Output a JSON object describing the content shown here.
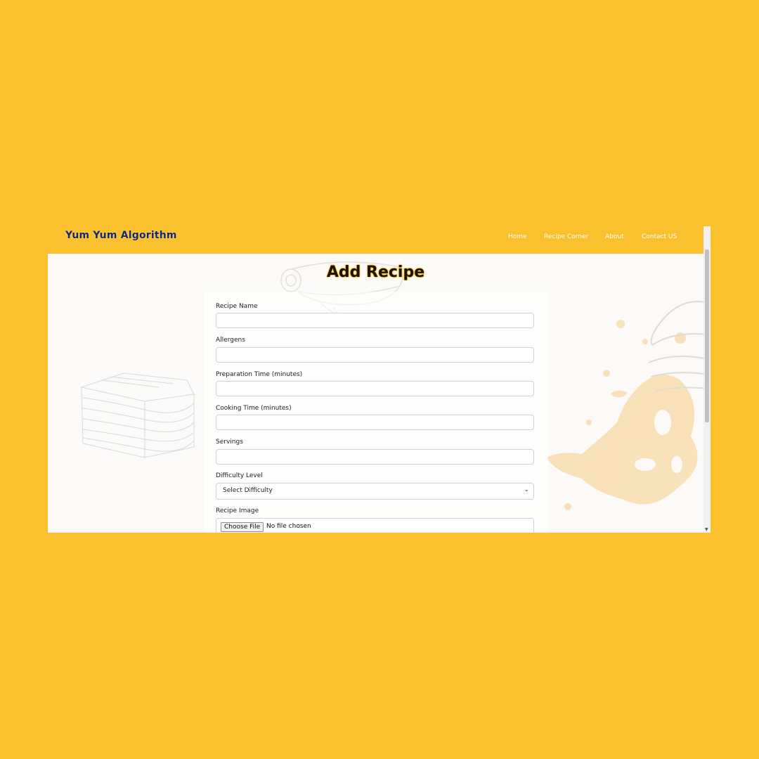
{
  "navbar": {
    "brand": "Yum Yum Algorithm",
    "links": [
      "Home",
      "Recipe Corner",
      "About",
      "Contact US"
    ]
  },
  "page": {
    "title": "Add Recipe"
  },
  "form": {
    "recipe_name_label": "Recipe Name",
    "recipe_name_value": "",
    "allergens_label": "Allergens",
    "allergens_value": "",
    "prep_time_label": "Preparation Time (minutes)",
    "prep_time_value": "",
    "cook_time_label": "Cooking Time (minutes)",
    "cook_time_value": "",
    "servings_label": "Servings",
    "servings_value": "",
    "difficulty_label": "Difficulty Level",
    "difficulty_selected": "Select Difficulty",
    "image_label": "Recipe Image",
    "file_button": "Choose File",
    "file_status": "No file chosen"
  },
  "icons": {
    "select_chevron": "chevron-down-icon",
    "scroll_down": "arrow-down-icon"
  },
  "colors": {
    "background": "#fbc02d",
    "brand_text": "#14286e",
    "nav_text": "#ffffff",
    "title_glow": "#f6b800"
  }
}
